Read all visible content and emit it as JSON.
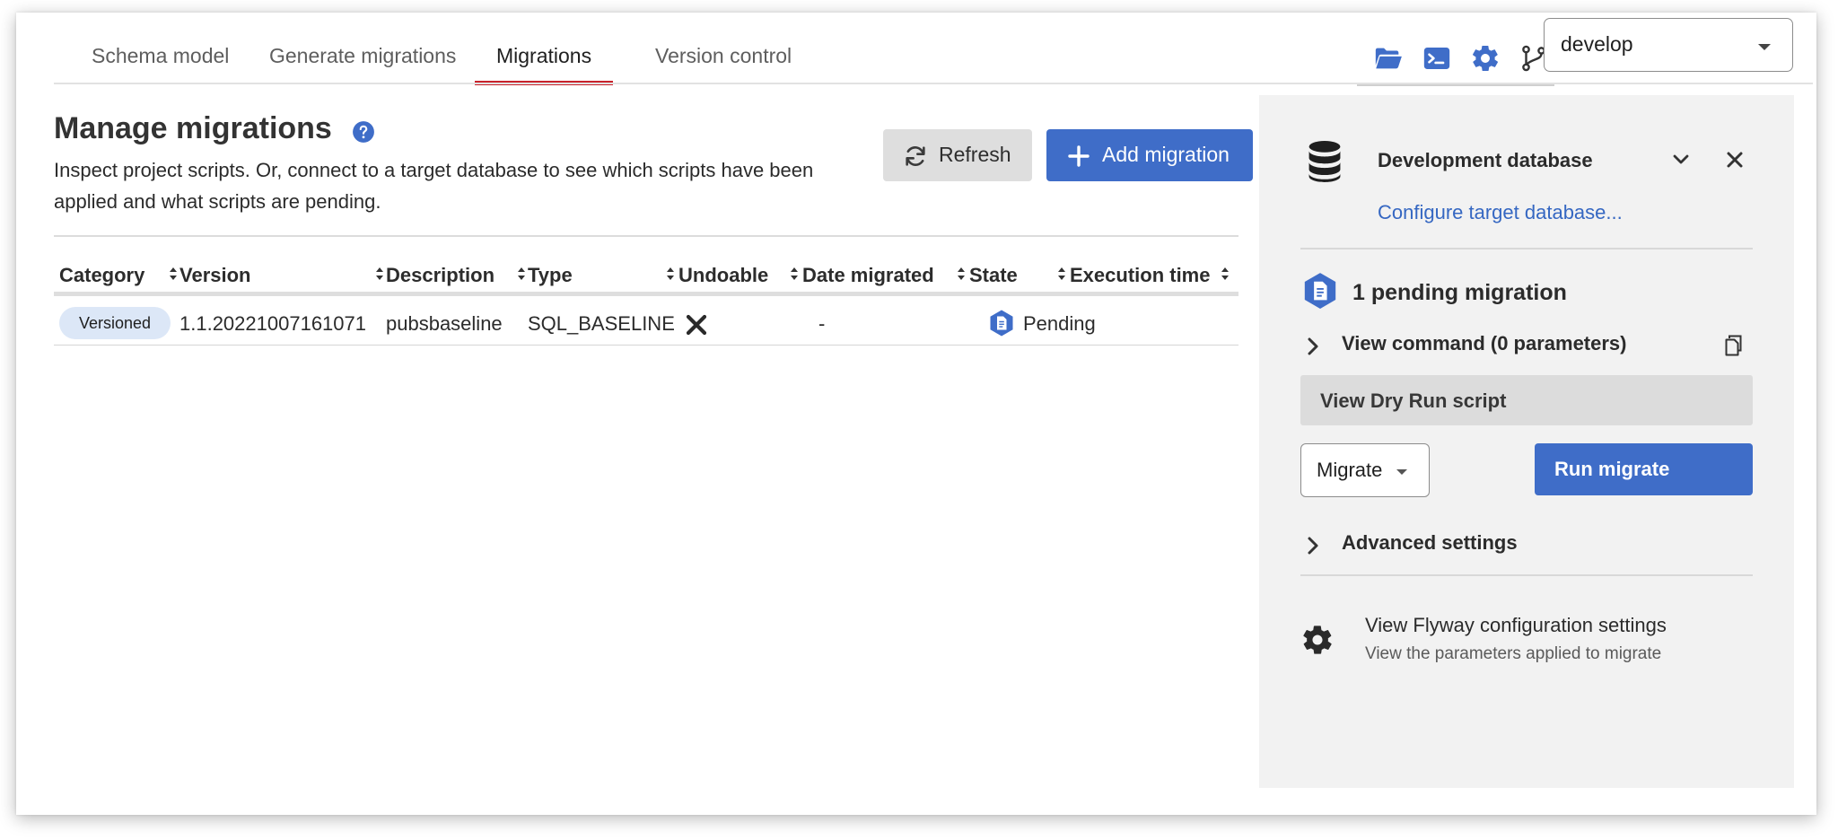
{
  "tabs": [
    {
      "label": "Schema model",
      "active": false
    },
    {
      "label": "Generate migrations",
      "active": false
    },
    {
      "label": "Migrations",
      "active": true
    },
    {
      "label": "Version control",
      "active": false
    }
  ],
  "toolbar": {
    "icons": [
      "folder-icon",
      "terminal-icon",
      "gear-icon",
      "git-branch-icon"
    ],
    "branch": "develop",
    "icon_color": "#3f6dc8"
  },
  "header": {
    "title": "Manage migrations",
    "subtitle": "Inspect project scripts. Or, connect to a target database to see which scripts have been applied and what scripts are pending.",
    "refresh_label": "Refresh",
    "add_label": "Add migration"
  },
  "table": {
    "columns": [
      "Category",
      "Version",
      "Description",
      "Type",
      "Undoable",
      "Date migrated",
      "State",
      "Execution time"
    ],
    "rows": [
      {
        "category": "Versioned",
        "version": "1.1.20221007161071",
        "description": "pubsbaseline",
        "type": "SQL_BASELINE",
        "undoable": "x-mark-icon",
        "date_migrated": "-",
        "state": "Pending",
        "execution_time": ""
      }
    ]
  },
  "panel": {
    "db_title": "Development database",
    "configure_link": "Configure target database...",
    "pending_title": "1 pending migration",
    "view_command": "View command (0 parameters)",
    "dry_run": "View Dry Run script",
    "command_select": "Migrate",
    "run_label": "Run migrate",
    "advanced": "Advanced settings",
    "flyway_title": "View Flyway configuration settings",
    "flyway_sub": "View the parameters applied to migrate"
  },
  "colors": {
    "accent": "#3f6dc8",
    "active_tab_underline": "#c8232b",
    "badge_bg": "#dce7f7",
    "panel_bg": "#f2f2f2"
  }
}
